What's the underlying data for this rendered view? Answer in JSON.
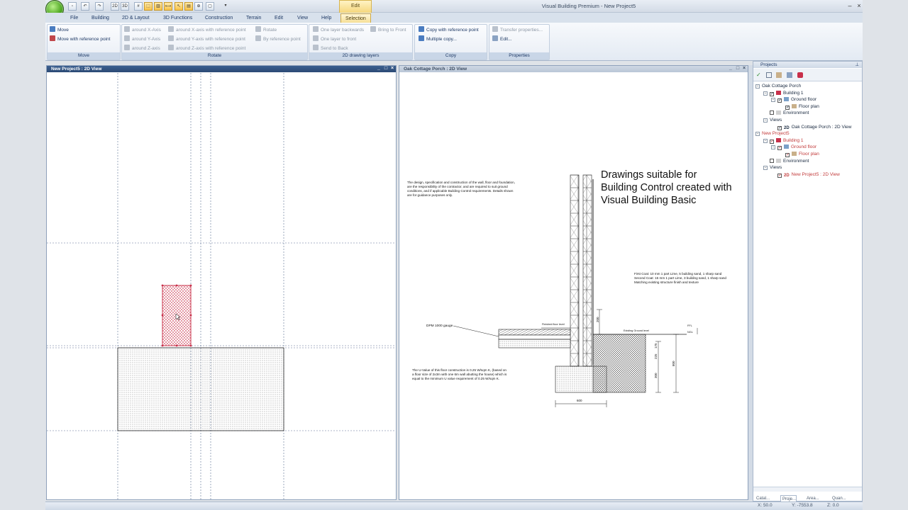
{
  "window": {
    "title": "Visual Building Premium - New Project5",
    "contextual_header": "Edit"
  },
  "quick_access": [
    "new",
    "undo",
    "redo",
    "2D",
    "3D",
    "grid",
    "select",
    "walls",
    "measure",
    "pointer",
    "import",
    "zoom",
    "page",
    "more"
  ],
  "tabs": [
    {
      "label": "File"
    },
    {
      "label": "Building"
    },
    {
      "label": "2D & Layout"
    },
    {
      "label": "3D Functions"
    },
    {
      "label": "Construction"
    },
    {
      "label": "Terrain"
    },
    {
      "label": "Edit"
    },
    {
      "label": "View"
    },
    {
      "label": "Help"
    },
    {
      "label": "Selection"
    }
  ],
  "ribbon": {
    "move": {
      "label": "Move",
      "items": [
        "Move",
        "Move with reference point"
      ]
    },
    "rotate": {
      "label": "Rotate",
      "items": [
        "around X-Axis",
        "around X-axis with reference point",
        "Rotate",
        "around Y-Axis",
        "around Y-axis with reference point",
        "By reference point",
        "around Z-axis",
        "around Z-axis with reference point"
      ]
    },
    "layers": {
      "label": "2D drawing layers",
      "items": [
        "One layer backwards",
        "Bring to Front",
        "One layer to front",
        "Send to Back"
      ]
    },
    "copy": {
      "label": "Copy",
      "items": [
        "Copy with reference point",
        "Multiple copy..."
      ]
    },
    "properties": {
      "label": "Properties",
      "items": [
        "Transfer properties...",
        "Edit..."
      ]
    }
  },
  "left_pane": {
    "title": "New Project5 : 2D View"
  },
  "right_pane": {
    "title": "Oak Cottage Porch : 2D View",
    "headline": [
      "Drawings suitable for",
      "Building Control created with",
      "Visual Building Basic"
    ],
    "note_top": [
      "The design, specification and construction of the wall, floor and foundation,",
      "are the responsibility of the contractor, and are required to suit ground",
      "conditions, and if applicable Building Control requirements. Details shown",
      "are for guidance purposes only."
    ],
    "note_render": [
      "First Coat: 10 mm 1 part Lime, 5 building sand, 1 sharp sand",
      "Second Coat: 15 mm 1 part Lime, 3 building sand, 1 sharp sand",
      "Matching existing structure finish and texture"
    ],
    "note_uvalue": [
      "The U-Value of this floor construction is 0.25 W/sqm K, (based on",
      "a floor size of 2x3m with one 6m wall abutting the house) which is",
      "equal to the minimum U value requirement of 0.25 W/sqm K."
    ],
    "dpm_label": "DPM 1000 gauge",
    "finished_floor": "Finished floor level",
    "ground_level": "Existing Ground level",
    "ffl": "FFL",
    "ngl": "NGL",
    "dim_200": "200",
    "dim_225": "225",
    "dim_175": "175",
    "dim_300": "300",
    "dim_800v": "800",
    "dim_600": "600"
  },
  "projects": {
    "title": "Projects",
    "tree": [
      {
        "label": "Oak Cottage Porch",
        "indent": 0,
        "exp": "-"
      },
      {
        "label": "Building 1",
        "indent": 1,
        "exp": "-",
        "check": true,
        "icon": "building"
      },
      {
        "label": "Ground floor",
        "indent": 2,
        "exp": "-",
        "check": true,
        "icon": "floor"
      },
      {
        "label": "Floor plan",
        "indent": 3,
        "check": true,
        "icon": "plan"
      },
      {
        "label": "Environment",
        "indent": 1,
        "check": false,
        "icon": "env"
      },
      {
        "label": "Views",
        "indent": 1,
        "exp": "-"
      },
      {
        "label": "Oak Cottage Porch : 2D View",
        "indent": 2,
        "check": true,
        "icon": "2d"
      },
      {
        "label": "New Project5",
        "indent": 0,
        "exp": "-",
        "red": true
      },
      {
        "label": "Building 1",
        "indent": 1,
        "exp": "-",
        "check": true,
        "icon": "building",
        "red": true
      },
      {
        "label": "Ground floor",
        "indent": 2,
        "exp": "-",
        "check": true,
        "icon": "floor",
        "red": true
      },
      {
        "label": "Floor plan",
        "indent": 3,
        "check": true,
        "icon": "plan",
        "red": true
      },
      {
        "label": "Environment",
        "indent": 1,
        "check": false,
        "icon": "env"
      },
      {
        "label": "Views",
        "indent": 1,
        "exp": "-"
      },
      {
        "label": "New Project5 : 2D View",
        "indent": 2,
        "check": true,
        "icon": "2d",
        "red": true
      }
    ],
    "bottom_tabs": [
      "Catal...",
      "Proje...",
      "Area...",
      "Quan..."
    ]
  },
  "status": {
    "x": "X: 50.0",
    "y": "Y: -7553.8",
    "z": "Z: 0.0"
  },
  "colors": {
    "accent": "#2b4a75",
    "selection": "#c8304a",
    "context_tab": "#f6df97"
  }
}
